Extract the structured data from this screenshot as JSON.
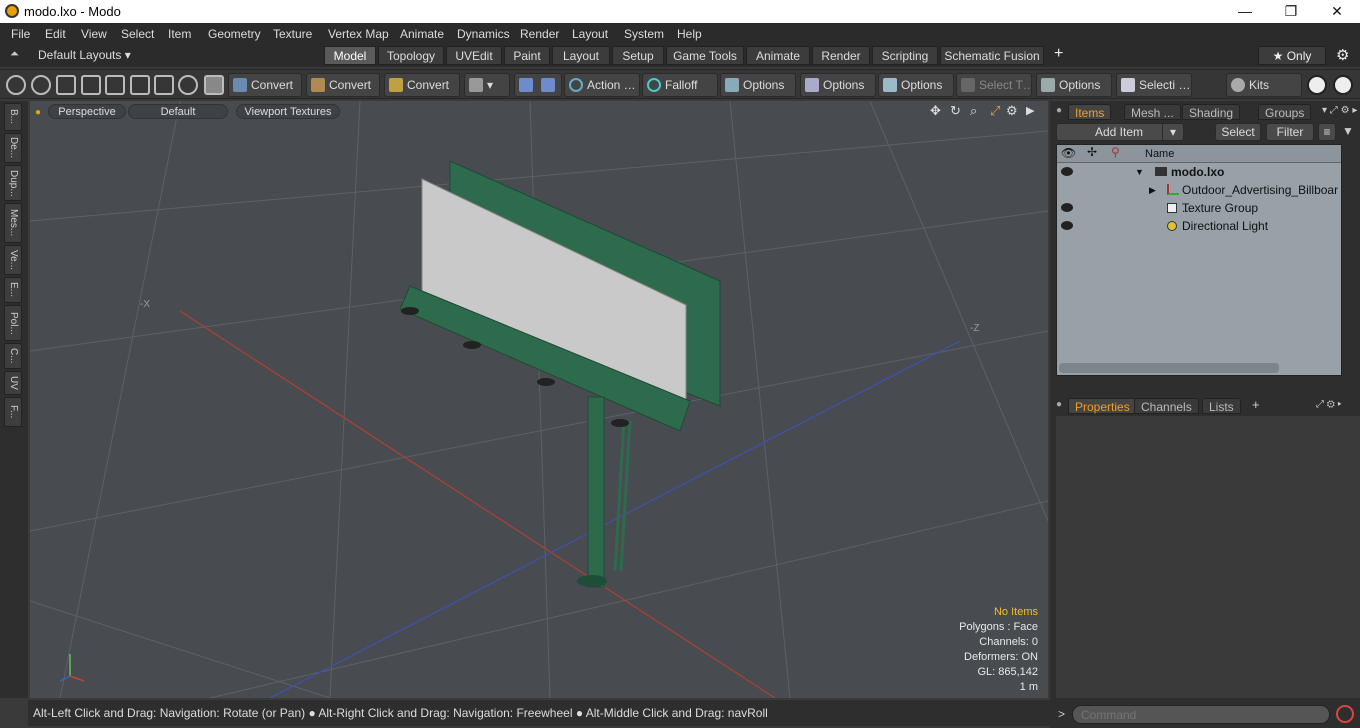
{
  "window": {
    "title": "modo.lxo - Modo",
    "min": "—",
    "max": "❐",
    "close": "✕"
  },
  "menu": [
    "File",
    "Edit",
    "View",
    "Select",
    "Item",
    "Geometry",
    "Texture",
    "Vertex Map",
    "Animate",
    "Dynamics",
    "Render",
    "Layout",
    "System",
    "Help"
  ],
  "layouts": {
    "selector": "Default Layouts ▾",
    "tabs": [
      "Model",
      "Topology",
      "UVEdit",
      "Paint",
      "Layout",
      "Setup",
      "Game Tools",
      "Animate",
      "Render",
      "Scripting",
      "Schematic Fusion"
    ],
    "active": "Model",
    "add": "+",
    "only": "★  Only",
    "gear": "⚙"
  },
  "toolbar": {
    "convert1": "Convert",
    "convert2": "Convert",
    "convert3": "Convert",
    "action": "Action  …",
    "falloff": "Falloff",
    "options1": "Options",
    "options2": "Options",
    "options3": "Options",
    "select_t": "Select T…",
    "options4": "Options",
    "selecti": "Selecti …",
    "kits": "Kits"
  },
  "left_tabs": [
    "B...",
    "De...",
    "Dup...",
    "Mes...",
    "Ve...",
    "E...",
    "Pol...",
    "C...",
    "UV",
    "F..."
  ],
  "viewport": {
    "perspective": "Perspective",
    "default": "Default",
    "textures": "Viewport Textures",
    "axis_x": "-X",
    "axis_z": "-Z",
    "hud": {
      "items": "No Items",
      "polygons": "Polygons : Face",
      "channels": "Channels: 0",
      "deformers": "Deformers: ON",
      "gl": "GL: 865,142",
      "unit": "1 m"
    },
    "hud_items_color": "#f0c020"
  },
  "status": "Alt-Left Click and Drag: Navigation: Rotate (or Pan) ● Alt-Right Click and Drag: Navigation: Freewheel ● Alt-Middle Click and Drag: navRoll",
  "items_panel": {
    "tabs": [
      "Items",
      "Mesh ...",
      "Shading",
      "Groups"
    ],
    "active": "Items",
    "add_item": "Add Item",
    "select": "Select",
    "filter": "Filter",
    "name_header": "Name",
    "rows": [
      {
        "label": "modo.lxo",
        "bold": true
      },
      {
        "label": "Outdoor_Advertising_Billboar ..."
      },
      {
        "label": "Texture Group"
      },
      {
        "label": "Directional Light"
      }
    ]
  },
  "props_panel": {
    "tabs": [
      "Properties",
      "Channels",
      "Lists"
    ],
    "active": "Properties",
    "add": "+"
  },
  "command": {
    "placeholder": "Command",
    "prompt": ">"
  }
}
